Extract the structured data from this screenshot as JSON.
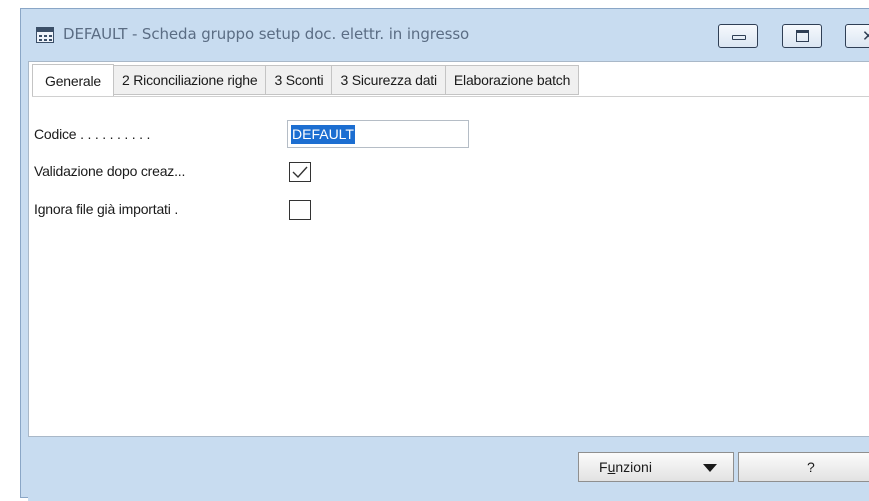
{
  "window": {
    "title": "DEFAULT - Scheda gruppo setup doc. elettr. in ingresso",
    "icons": {
      "app": "table-icon",
      "minimize": "minimize-icon",
      "maximize": "maximize-icon",
      "close": "close-icon"
    }
  },
  "tabs": [
    {
      "label": "Generale",
      "active": true
    },
    {
      "label": "2 Riconciliazione righe",
      "active": false
    },
    {
      "label": "3 Sconti",
      "active": false
    },
    {
      "label": "3 Sicurezza dati",
      "active": false
    },
    {
      "label": "Elaborazione batch",
      "active": false
    }
  ],
  "form": {
    "codice": {
      "label": "Codice . . . . . . . . . .",
      "value": "DEFAULT"
    },
    "validazione": {
      "label": "Validazione dopo creaz...",
      "checked": true
    },
    "ignora": {
      "label": "Ignora file già importati  .",
      "checked": false
    }
  },
  "buttons": {
    "funzioni": {
      "label_pre": "F",
      "label_ul": "u",
      "label_post": "nzioni"
    },
    "help": "?"
  },
  "colors": {
    "selection": "#1c6ed1",
    "frame": "#c8dcf0"
  }
}
